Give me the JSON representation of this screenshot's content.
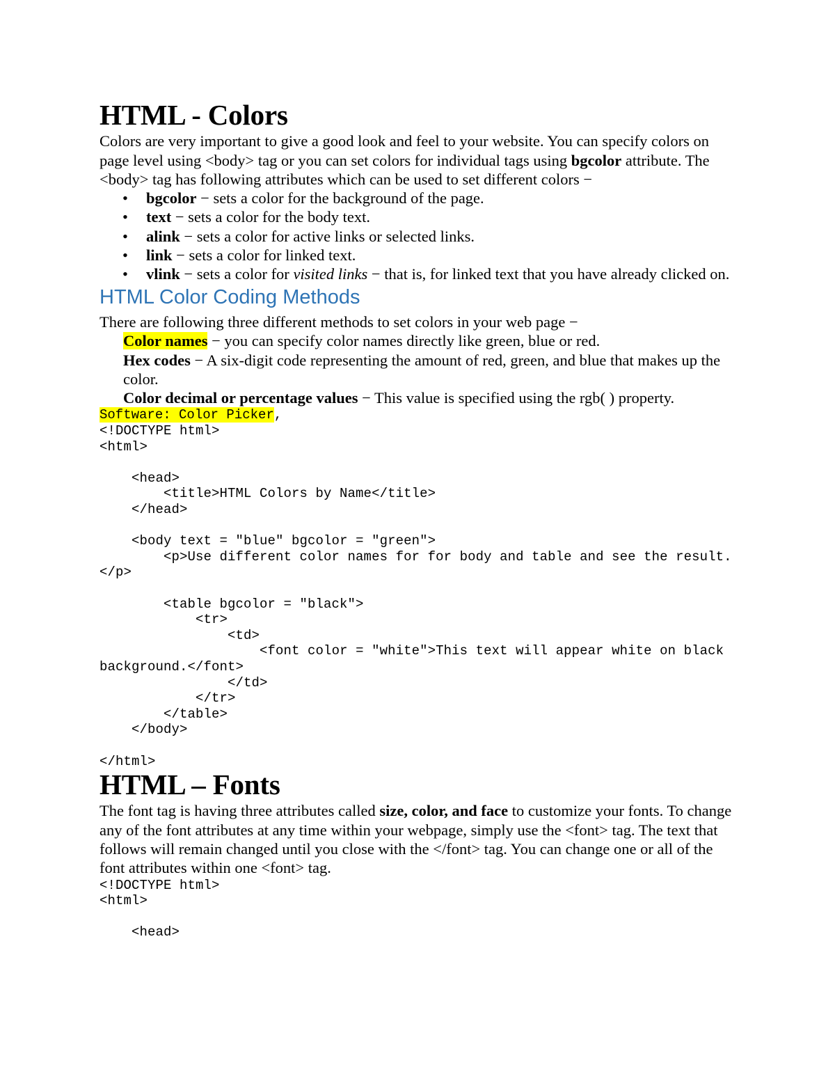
{
  "document": {
    "sections": [
      {
        "id": "colors",
        "heading": "HTML - Colors",
        "intro": {
          "part1": "Colors are very important to give a good look and feel to your website. You can specify colors on page level using <body> tag or you can set colors for individual tags using ",
          "bold1": "bgcolor",
          "part2": " attribute. The <body> tag has following attributes which can be used to set different colors −"
        },
        "attributes": [
          {
            "bullet": "•",
            "name": "bgcolor",
            "desc": " − sets a color for the background of the page."
          },
          {
            "bullet": "•",
            "name": "text",
            "desc": " − sets a color for the body text."
          },
          {
            "bullet": "•",
            "name": "alink",
            "desc": " − sets a color for active links or selected links."
          },
          {
            "bullet": "•",
            "name": "link",
            "desc": " − sets a color for linked text."
          },
          {
            "bullet": "•",
            "name": "vlink",
            "desc_before": " − sets a color for ",
            "desc_italic": "visited links",
            "desc_after": " − that is, for linked text that you have already clicked on."
          }
        ],
        "subheading": "HTML Color Coding Methods",
        "methods_intro": "There are following three different methods to set colors in your web page −",
        "methods": [
          {
            "term": "Color names",
            "term_highlighted": true,
            "desc": " − you can specify color names directly like green, blue or red."
          },
          {
            "term": "Hex codes",
            "term_highlighted": false,
            "desc": " − A six-digit code representing the amount of red, green, and blue that makes up the color."
          },
          {
            "term": "Color decimal or percentage values",
            "term_highlighted": false,
            "desc": " − This value is specified using the rgb( ) property."
          }
        ],
        "software_note": {
          "highlighted": "Software: Color Picker",
          "trailing": ","
        },
        "code": "<!DOCTYPE html>\n<html>\n\n    <head>\n        <title>HTML Colors by Name</title>\n    </head>\n\n    <body text = \"blue\" bgcolor = \"green\">\n        <p>Use different color names for for body and table and see the result.</p>\n\n        <table bgcolor = \"black\">\n            <tr>\n                <td>\n                    <font color = \"white\">This text will appear white on black background.</font>\n                </td>\n            </tr>\n        </table>\n    </body>\n\n</html>"
      },
      {
        "id": "fonts",
        "heading": "HTML – Fonts",
        "intro": {
          "part1": "The font tag is having three attributes called ",
          "bold1": "size, color, and face",
          "part2": " to customize your fonts. To change any of the font attributes at any time within your webpage, simply use the <font> tag. The text that follows will remain changed until you close with the </font> tag. You can change one or all of the font attributes within one <font> tag."
        },
        "code": "<!DOCTYPE html>\n<html>\n\n    <head>"
      }
    ]
  },
  "colors": {
    "heading_blue": "#2E74B5",
    "highlight_yellow": "#FFFF00",
    "text_black": "#000000",
    "page_background": "#FFFFFF"
  }
}
